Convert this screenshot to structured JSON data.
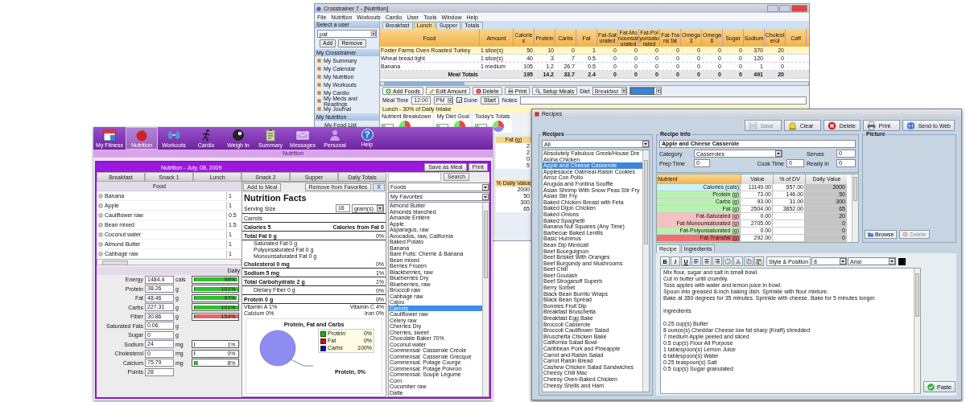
{
  "back_window": {
    "title": "Crosstrainer 7 - [Nutrition]",
    "menu": [
      "File",
      "Nutrition",
      "Workouts",
      "Cardio",
      "User",
      "Tools",
      "Window",
      "Help"
    ],
    "sidebar": [
      {
        "kind": "user",
        "title": "Select a user",
        "user": "pat",
        "buttons": [
          "Add",
          "Remove"
        ]
      },
      {
        "kind": "links",
        "title": "My Crosstrainer",
        "items": [
          "My Summary",
          "My Calendar",
          "My Nutrition",
          "My Workouts",
          "My Cardio",
          "My Meds and Readings",
          "My Journal"
        ]
      },
      {
        "kind": "plain",
        "title": "My Nutrition",
        "items": [
          "My Food List"
        ]
      }
    ],
    "tabs": [
      {
        "label": "Breakfast",
        "selected": false
      },
      {
        "label": "Lunch",
        "selected": true
      },
      {
        "label": "Supper",
        "selected": false
      },
      {
        "label": "Totals",
        "selected": false
      }
    ],
    "table": {
      "columns": [
        "Food",
        "Amount",
        "Calories",
        "Protein",
        "Carbs",
        "Fat",
        "Fat-Saturated",
        "Fat-Monounsaturated",
        "Fat-Polyunsaturated",
        "Fat-Trans fat",
        "Omega 3",
        "Omega 6",
        "Sugar",
        "Sodium",
        "Cholesterol",
        "Caff"
      ],
      "rows": [
        {
          "kind": "item",
          "selected": true,
          "food": "Foster Farms Oven Roasted Turkey",
          "amount": "1 slice(s)",
          "values": [
            "50",
            "10",
            "0",
            "1",
            "0",
            "0",
            "0",
            "0",
            "0",
            "0",
            "0",
            "370",
            "20"
          ]
        },
        {
          "kind": "item",
          "selected": false,
          "food": "Wheat bread light",
          "amount": "1 slice(s)",
          "values": [
            "40",
            "3",
            "7",
            "0.5",
            "0",
            "0",
            "0",
            "0",
            "0",
            "0",
            "0",
            "120",
            "0"
          ]
        },
        {
          "kind": "item",
          "selected": false,
          "food": "Banana",
          "amount": "1 medium",
          "values": [
            "105",
            "1.2",
            "26.7",
            "0.5",
            "0",
            "0",
            "0",
            "0",
            "0",
            "0",
            "0",
            "1",
            "0"
          ]
        },
        {
          "kind": "total",
          "selected": false,
          "food": "Meal Totals",
          "values": [
            "195",
            "14.2",
            "33.7",
            "2.4",
            "0",
            "0",
            "0",
            "0",
            "0",
            "0",
            "0",
            "491",
            "20"
          ]
        }
      ]
    },
    "toolbar": [
      {
        "kind": "add",
        "label": "Add Foods"
      },
      {
        "kind": "edit",
        "label": "Edit Amount"
      },
      {
        "kind": "delete",
        "label": "Delete"
      },
      {
        "kind": "print",
        "label": "Print"
      },
      {
        "kind": "setup",
        "label": "Setup Meals"
      }
    ],
    "diet": {
      "label": "Diet",
      "value": "Breakfast"
    },
    "meal_time": {
      "label": "Meal Time",
      "time": "12:00",
      "ampm": "PM",
      "done": {
        "label": "Done",
        "checked": true
      },
      "start": "Start",
      "notes": "Notes"
    },
    "banner": "Lunch - 30% of Daily Intake",
    "charts": [
      "Nutrient Breakdown",
      "My Diet Goal",
      "Today's Totals"
    ],
    "mini_tables": [
      {
        "heading": "Fat (g)",
        "values": [
          "2",
          "2",
          "0",
          "5"
        ]
      },
      {
        "heading": "% Daily Value",
        "values": [
          "2000",
          "50",
          "300",
          "65"
        ]
      }
    ]
  },
  "fitness_window": {
    "nav": [
      {
        "kind": "calendar",
        "label": "My Fitness",
        "selected": false
      },
      {
        "kind": "apple",
        "label": "Nutrition",
        "selected": true
      },
      {
        "kind": "dumbbell",
        "label": "Workouts",
        "selected": false
      },
      {
        "kind": "runner",
        "label": "Cardio",
        "selected": false
      },
      {
        "kind": "ball",
        "label": "Weigh In",
        "selected": false
      },
      {
        "kind": "clipboard",
        "label": "Summary",
        "selected": false
      },
      {
        "kind": "envelope",
        "label": "Messages",
        "selected": false
      },
      {
        "kind": "person",
        "label": "Personal",
        "selected": false
      },
      {
        "kind": "help",
        "label": "Help",
        "glyph": "?",
        "selected": false
      }
    ],
    "section": "Nutrition",
    "panel_title": "Nutrition - July, 08, 2009",
    "panel_buttons": [
      "Save as Meal",
      "Print"
    ],
    "tabs": [
      {
        "label": "Breakfast",
        "selected": false
      },
      {
        "label": "Snack 1",
        "selected": false
      },
      {
        "label": "Lunch",
        "selected": false
      },
      {
        "label": "Snack 2",
        "selected": false
      },
      {
        "label": "Supper",
        "selected": false
      },
      {
        "label": "Daily Totals",
        "selected": false
      }
    ],
    "food_table": {
      "heading": "Food",
      "rows": [
        {
          "name": "Banana",
          "amount": "1"
        },
        {
          "name": "Apple",
          "amount": "1"
        },
        {
          "name": "Cauliflower raw",
          "amount": "0.5"
        },
        {
          "name": "Bean mixed",
          "amount": "1.5"
        },
        {
          "name": "Coconut water",
          "amount": "1"
        },
        {
          "name": "Almond Butter",
          "amount": "1"
        },
        {
          "name": "Cabbage raw",
          "amount": "1"
        }
      ]
    },
    "daily": {
      "heading": "Daily",
      "rows": [
        {
          "kind": "bar",
          "label": "Energy",
          "value": "1484.4",
          "unit": "cals",
          "level": 0.99,
          "reading": "99%",
          "over": false
        },
        {
          "kind": "bar",
          "label": "Protein",
          "value": "38.26",
          "unit": "g",
          "level": 1,
          "reading": "101%",
          "over": false
        },
        {
          "kind": "bar",
          "label": "Fat",
          "value": "48.46",
          "unit": "g",
          "level": 0.97,
          "reading": "97%",
          "over": false
        },
        {
          "kind": "bar",
          "label": "Carbs",
          "value": "227.31",
          "unit": "g",
          "level": 1,
          "reading": "101%",
          "over": false
        },
        {
          "kind": "bar",
          "label": "Fiber",
          "value": "30.86",
          "unit": "g",
          "level": 1,
          "reading": "154%",
          "over": true
        },
        {
          "kind": "plain",
          "label": "Saturated Fats",
          "value": "0.06",
          "unit": "g"
        },
        {
          "kind": "plain",
          "label": "Sugar",
          "value": "0",
          "unit": "g"
        },
        {
          "kind": "bar",
          "label": "Sodium",
          "value": "24",
          "unit": "mg",
          "level": 0.01,
          "reading": "1%"
        },
        {
          "kind": "bar",
          "label": "Cholesterol",
          "value": "0",
          "unit": "mg",
          "level": 0,
          "reading": "0%"
        },
        {
          "kind": "bar",
          "label": "Calcium",
          "value": "75.79",
          "unit": "mg",
          "level": 0.08,
          "reading": "8%",
          "over": false
        },
        {
          "kind": "plain",
          "label": "Points",
          "value": "28"
        }
      ]
    },
    "facts": {
      "buttons": [
        "Add to Meal",
        "Remove from Favorites",
        "X"
      ],
      "title": "Nutrition Facts",
      "serving_label": "Serving Size",
      "serving": "16",
      "unit": "gram(s)",
      "food": "Carrots",
      "calories": "Calories 5",
      "calories_fat": "Calories from Fat 0",
      "lines": [
        {
          "kind": "main",
          "label": "Total Fat 0 g",
          "pct": "0%"
        },
        {
          "kind": "sub",
          "label": "Saturated Fat 0 g"
        },
        {
          "kind": "sub",
          "label": "Polyunsaturated Fat 0 g"
        },
        {
          "kind": "sub",
          "label": "Monounsaturated Fat 0 g"
        },
        {
          "kind": "main",
          "label": "Cholesterol 0 mg",
          "pct": "0%"
        },
        {
          "kind": "main",
          "label": "Sodium 5 mg",
          "pct": "1%"
        },
        {
          "kind": "main",
          "label": "Total Carbohydrate 2 g",
          "pct": "1%"
        },
        {
          "kind": "sub",
          "label": "Dietary Fiber 0 g",
          "pct": "0%"
        },
        {
          "kind": "main",
          "label": "Protein 0 g",
          "pct": "0%"
        }
      ],
      "vitamins": [
        [
          "Vitamin A 1%",
          "Vitamin C 4%"
        ],
        [
          "Calcium 0%",
          "Iron 0%"
        ]
      ],
      "chart_data": {
        "type": "pie",
        "title": "Protein, Fat and Carbs",
        "categories": [
          "Protein",
          "Fat",
          "Carbs"
        ],
        "values": [
          0,
          0,
          100
        ],
        "colors": [
          "#00c000",
          "#e00000",
          "#0000e0"
        ],
        "value_labels": [
          "0%",
          "0%",
          "100%"
        ],
        "annotations": [
          {
            "text": "Protein, 0%"
          }
        ]
      }
    },
    "foods": {
      "search_button": "Search",
      "source": "Foods",
      "list_name": "My Favorites",
      "items": [
        {
          "label": "Almond Butter",
          "selected": false
        },
        {
          "label": "Almonds blanched",
          "selected": false
        },
        {
          "label": "Amande Entière",
          "selected": false
        },
        {
          "label": "Apple",
          "selected": false
        },
        {
          "label": "Asparagus, raw",
          "selected": false
        },
        {
          "label": "Avocados, raw, California",
          "selected": false
        },
        {
          "label": "Baked Potato",
          "selected": false
        },
        {
          "label": "Banana",
          "selected": false
        },
        {
          "label": "Bare Fuits: Cherrie & Banana",
          "selected": false
        },
        {
          "label": "Bean mixed",
          "selected": false
        },
        {
          "label": "Berries Frozen",
          "selected": false
        },
        {
          "label": "Blackberries, raw",
          "selected": false
        },
        {
          "label": "Blueberries Dry",
          "selected": false
        },
        {
          "label": "Blueberries, raw",
          "selected": false
        },
        {
          "label": "Broccoli raw",
          "selected": false
        },
        {
          "label": "Cabbage raw",
          "selected": false
        },
        {
          "label": "Cajou",
          "selected": false
        },
        {
          "label": "Carrots",
          "selected": true
        },
        {
          "label": "Cauliflower raw",
          "selected": false
        },
        {
          "label": "Celery raw",
          "selected": false
        },
        {
          "label": "Cherries Dry",
          "selected": false
        },
        {
          "label": "Cherries, sweet",
          "selected": false
        },
        {
          "label": "Chocolate Baker 70%",
          "selected": false
        },
        {
          "label": "Coconut water",
          "selected": false
        },
        {
          "label": "Commensal: Casserole Créole",
          "selected": false
        },
        {
          "label": "Commensal: Casserole Grecque",
          "selected": false
        },
        {
          "label": "Commensal: Potage Courge",
          "selected": false
        },
        {
          "label": "Commensal: Potage Poivron",
          "selected": false
        },
        {
          "label": "Commensal: Soupe Légume",
          "selected": false
        },
        {
          "label": "Corn",
          "selected": false
        },
        {
          "label": "Cucumber raw",
          "selected": false
        },
        {
          "label": "Datte",
          "selected": false
        }
      ]
    }
  },
  "recipes_window": {
    "title": "Recipes",
    "toolbar": [
      {
        "kind": "save",
        "label": "Save",
        "disabled": true
      },
      {
        "kind": "clear",
        "label": "Clear",
        "disabled": false
      },
      {
        "kind": "delete",
        "label": "Delete",
        "disabled": false
      },
      {
        "kind": "print",
        "label": "Print",
        "disabled": false
      },
      {
        "kind": "web",
        "label": "Send to Web",
        "disabled": false
      }
    ],
    "list_group": "Recipes",
    "filter": "All",
    "recipes": [
      {
        "label": "Absolutely Fabulous Greek/House Dre",
        "selected": false
      },
      {
        "label": "Aloha Chicken",
        "selected": false
      },
      {
        "label": "Apple and Cheese Casserole",
        "selected": true
      },
      {
        "label": "Applesauce Oatmeal-Raisin Cookies",
        "selected": false
      },
      {
        "label": "Arroz Con Pollo",
        "selected": false
      },
      {
        "label": "Arugula and Fontina Souffle",
        "selected": false
      },
      {
        "label": "Asian Shrimp With Snow Peas Stir Fry",
        "selected": false
      },
      {
        "label": "Asian Stir Fry",
        "selected": false
      },
      {
        "label": "Baked Chicken Breast with Feta",
        "selected": false
      },
      {
        "label": "Baked Dijon Chicken",
        "selected": false
      },
      {
        "label": "Baked Onions",
        "selected": false
      },
      {
        "label": "Baked Spaghetti",
        "selected": false
      },
      {
        "label": "Banana Nut Squares (Any Time)",
        "selected": false
      },
      {
        "label": "Barbecue Baked Lentils",
        "selected": false
      },
      {
        "label": "Basic Hummus",
        "selected": false
      },
      {
        "label": "Bean Dip Mexicali",
        "selected": false
      },
      {
        "label": "Beef Bourguignon",
        "selected": false
      },
      {
        "label": "Beef Brisket With Oranges",
        "selected": false
      },
      {
        "label": "Beef Burgundy and Mushrooms",
        "selected": false
      },
      {
        "label": "Beef Chili",
        "selected": false
      },
      {
        "label": "Beef Goulash",
        "selected": false
      },
      {
        "label": "Beef Stroganoff Superb",
        "selected": false
      },
      {
        "label": "Berry Sorbet",
        "selected": false
      },
      {
        "label": "Black Bean Burrito Wraps",
        "selected": false
      },
      {
        "label": "Black Bean Spread",
        "selected": false
      },
      {
        "label": "Bonnies Fruit Dip",
        "selected": false
      },
      {
        "label": "Breakfast Bruschetta",
        "selected": false
      },
      {
        "label": "Breakfast Egg Bake",
        "selected": false
      },
      {
        "label": "Broccoli Casserole",
        "selected": false
      },
      {
        "label": "Broccoli Cauliflower Salad",
        "selected": false
      },
      {
        "label": "Bruschetta Chicken Bake",
        "selected": false
      },
      {
        "label": "California Salad Bowl",
        "selected": false
      },
      {
        "label": "Caribbean Pork and Pineapple",
        "selected": false
      },
      {
        "label": "Carrot and Raisin Salad",
        "selected": false
      },
      {
        "label": "Carrot Raisin Bread",
        "selected": false
      },
      {
        "label": "Cashew Chicken Salad Sandwiches",
        "selected": false
      },
      {
        "label": "Cheesy Chili Mac",
        "selected": false
      },
      {
        "label": "Cheesy Oven-Baked Chicken",
        "selected": false
      },
      {
        "label": "Cheesy Shells and Ham",
        "selected": false
      }
    ],
    "info_group": "Recipe Info",
    "name": "Apple and Cheese Casserole",
    "category": {
      "label": "Category",
      "value": "Casseroles"
    },
    "fields": [
      {
        "label": "Serves",
        "value": "0"
      },
      {
        "label": "Prep Time",
        "value": "0"
      },
      {
        "label": "Cook Time",
        "value": "0"
      },
      {
        "label": "Ready in",
        "value": "0"
      }
    ],
    "picture_group": "Picture",
    "picture_buttons": [
      {
        "kind": "browse",
        "label": "Browse",
        "disabled": false
      },
      {
        "kind": "delete",
        "label": "Delete",
        "disabled": true
      }
    ],
    "nutrients": {
      "columns": [
        "Nutrient",
        "Value",
        "% of DV",
        "Daily Value"
      ],
      "rows": [
        {
          "name": "Calories (cals)",
          "value": "11149.00",
          "dv": "557.00",
          "daily": "2000",
          "color": "#c6f4f8"
        },
        {
          "name": "Protein (g)",
          "value": "73.00",
          "dv": "146.00",
          "daily": "50",
          "color": "#b9f2b0"
        },
        {
          "name": "Carbs (g)",
          "value": "93.00",
          "dv": "31.00",
          "daily": "300",
          "color": "#b9f2b0"
        },
        {
          "name": "Fat (g)",
          "value": "2504.00",
          "dv": "3852.00",
          "daily": "65",
          "color": "#b9f2b0"
        },
        {
          "name": "Fat-Saturated (g)",
          "value": "0.00",
          "daily": "20",
          "color": "#f8c0c0"
        },
        {
          "name": "Fat-Monounsaturated (g)",
          "value": "2705.00",
          "daily": "0",
          "color": "#f8c0c0"
        },
        {
          "name": "Fat-Polyunsaturated (g)",
          "value": "0.00",
          "daily": "0",
          "color": "#b9f2b0"
        },
        {
          "name": "Fat-Transfat (g)",
          "value": "292.00",
          "daily": "0",
          "color": "#f07070"
        }
      ]
    },
    "tabs": [
      {
        "label": "Recipe",
        "selected": true
      },
      {
        "label": "Ingredients",
        "selected": false
      }
    ],
    "format": {
      "text_buttons": [
        "B",
        "I",
        "U"
      ],
      "style_button": "Style & Position",
      "size": "8",
      "font": "Arial"
    },
    "instructions": [
      "Mix flour, sugar and salt in small bowl.",
      "Cut in butter until crumbly.",
      "Toss apples with water and lemon juice in bowl.",
      "Spoon into greased 8-inch baking dish. Sprinkle with flour mixture.",
      "Bake at 350 degrees for 35 minutes. Sprinkle with cheese. Bake for 5 minutes longer."
    ],
    "ingredients_heading": "Ingredients",
    "ingredients": [
      "0.25 cup(s) Butter",
      "8 ounce(s) Cheddar Cheese low fat sharp (Kraft)  shredded",
      "7 medium Apple  peeled and sliced",
      "0.5 cup(s) Flour All Purpose",
      "1 tablespoon(s) Lemon Juice",
      "6 tablespoon(s) Water",
      "0.25 teaspoon(s) Salt",
      "0.5 cup(s) Sugar granulated"
    ],
    "paste": "Paste"
  }
}
